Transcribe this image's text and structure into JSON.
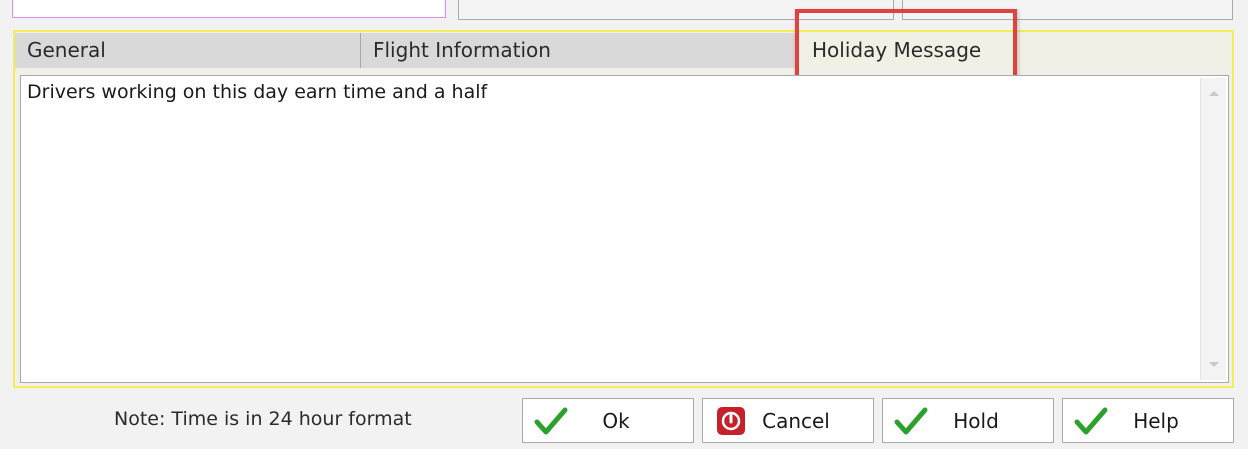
{
  "tabs": {
    "general": "General",
    "flight_information": "Flight Information",
    "holiday_message": "Holiday Message"
  },
  "memo": {
    "text": "Drivers working on this day earn time and a half"
  },
  "footer": {
    "note": "Note: Time is in 24 hour format",
    "buttons": {
      "ok": "Ok",
      "cancel": "Cancel",
      "hold": "Hold",
      "help": "Help"
    }
  },
  "colors": {
    "accent_highlight": "#e04141",
    "panel_border": "#f5ec5a",
    "check_green": "#2aa12a",
    "cancel_red": "#c8202a"
  },
  "icons": {
    "ok": "checkmark-icon",
    "cancel": "power-stop-icon",
    "hold": "checkmark-icon",
    "help": "checkmark-icon",
    "scroll_up": "arrow-up-icon",
    "scroll_down": "arrow-down-icon"
  }
}
